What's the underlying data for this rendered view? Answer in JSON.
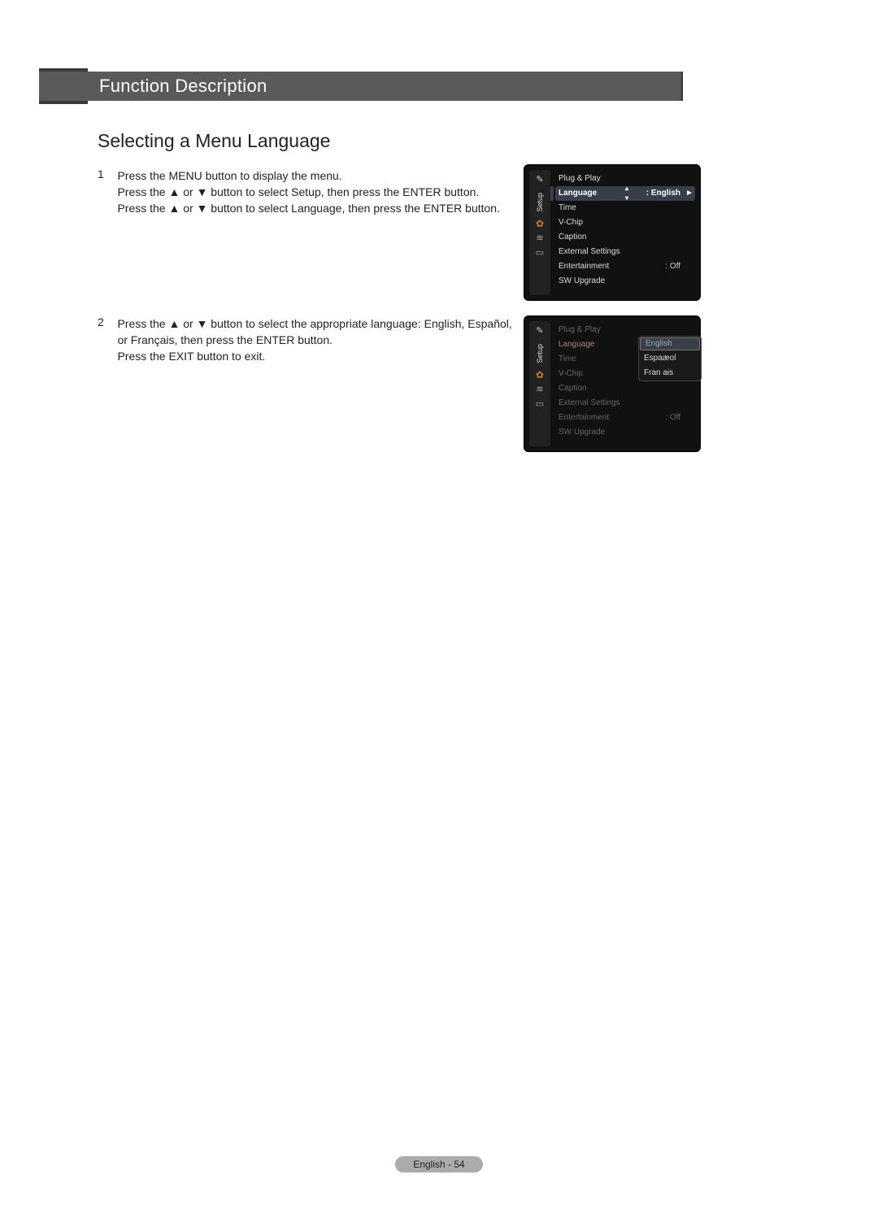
{
  "header": {
    "title": "Function Description"
  },
  "section": {
    "title": "Selecting a Menu Language"
  },
  "steps": {
    "s1": {
      "num": "1",
      "line1": "Press the MENU button to display the menu.",
      "line2": "Press the ▲ or ▼ button to select Setup, then press the ENTER button.",
      "line3": "Press the ▲ or ▼ button to select Language, then press the ENTER button."
    },
    "s2": {
      "num": "2",
      "line1": "Press the ▲ or ▼ button to select the appropriate language: English, Español, or Français, then press the ENTER button.",
      "exit": "Press the EXIT button to exit."
    }
  },
  "menu1": {
    "sidebar_label": "Setup",
    "items": {
      "0": {
        "label": "Plug & Play"
      },
      "1": {
        "label": "Language",
        "value": ": English",
        "selected": true
      },
      "2": {
        "label": "Time"
      },
      "3": {
        "label": "V-Chip"
      },
      "4": {
        "label": "Caption"
      },
      "5": {
        "label": "External Settings"
      },
      "6": {
        "label": "Entertainment",
        "value": ": Off"
      },
      "7": {
        "label": "SW Upgrade"
      }
    }
  },
  "menu2": {
    "sidebar_label": "Setup",
    "items": {
      "0": {
        "label": "Plug & Play"
      },
      "1": {
        "label": "Language",
        "value": ":"
      },
      "2": {
        "label": "Time"
      },
      "3": {
        "label": "V-Chip"
      },
      "4": {
        "label": "Caption"
      },
      "5": {
        "label": "External Settings"
      },
      "6": {
        "label": "Entertainment",
        "value": ": Off"
      },
      "7": {
        "label": "SW Upgrade"
      }
    },
    "dropdown": {
      "0": "English",
      "1": "Espaæol",
      "2": "Fran ais"
    }
  },
  "footer": {
    "text": "English - 54"
  },
  "glyphs": {
    "arrow_right": "►"
  }
}
